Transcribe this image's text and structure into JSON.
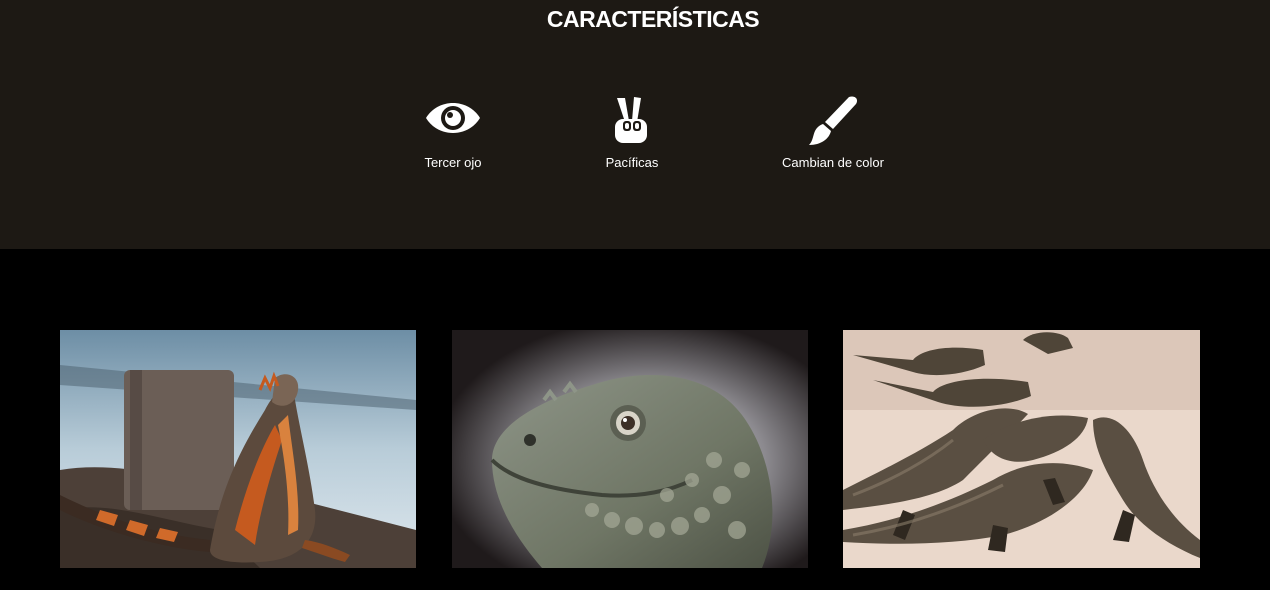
{
  "features": {
    "title": "CARACTERÍSTICAS",
    "items": [
      {
        "icon": "eye-icon",
        "label": "Tercer ojo"
      },
      {
        "icon": "peace-hand-icon",
        "label": "Pacíficas"
      },
      {
        "icon": "paint-brush-icon",
        "label": "Cambian de color"
      }
    ]
  },
  "colors": {
    "features_background": "#1d1914",
    "gallery_background": "#000000",
    "text": "#ffffff"
  },
  "gallery": {
    "images": [
      {
        "subject": "iguana-by-water"
      },
      {
        "subject": "iguana-head-closeup"
      },
      {
        "subject": "iguanas-on-sand"
      }
    ]
  }
}
